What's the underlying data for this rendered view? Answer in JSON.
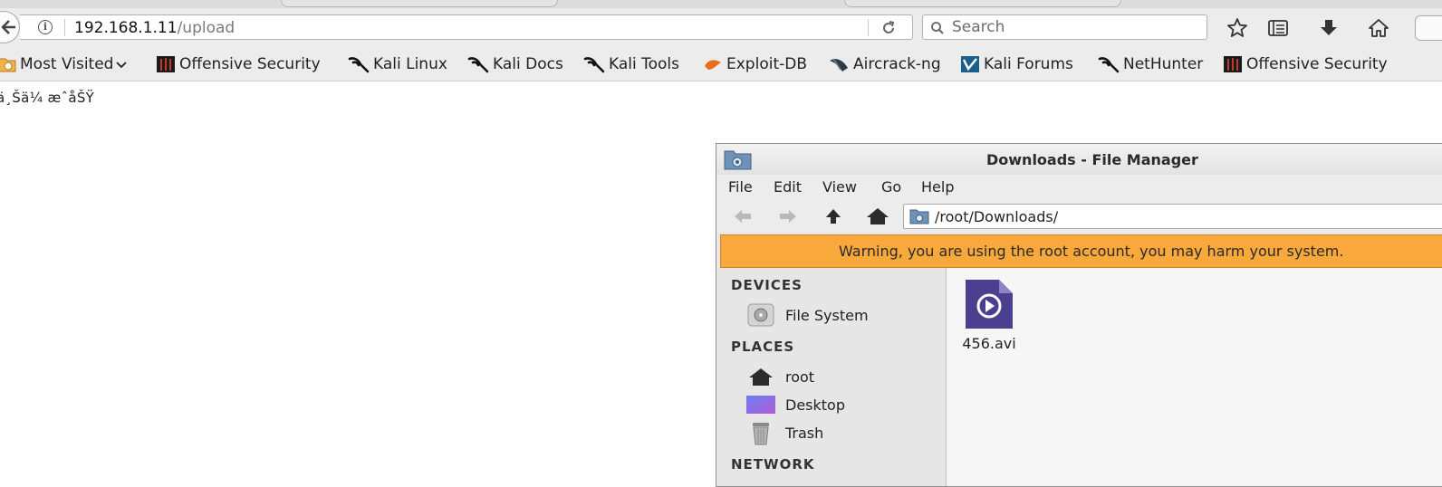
{
  "browser": {
    "url_host": "192.168.1.11",
    "url_path": "/upload",
    "search_placeholder": "Search",
    "toolbar_icons": [
      "back-icon",
      "info-icon",
      "reload-icon",
      "search-icon",
      "bookmark-star-icon",
      "reading-list-icon",
      "download-icon",
      "home-icon"
    ]
  },
  "bookmarks": [
    {
      "label": "Most Visited",
      "icon": "folder-clock-icon"
    },
    {
      "label": "Offensive Security",
      "icon": "offsec-icon"
    },
    {
      "label": "Kali Linux",
      "icon": "kali-dragon-icon"
    },
    {
      "label": "Kali Docs",
      "icon": "kali-dragon-icon"
    },
    {
      "label": "Kali Tools",
      "icon": "kali-dragon-icon"
    },
    {
      "label": "Exploit-DB",
      "icon": "exploitdb-icon"
    },
    {
      "label": "Aircrack-ng",
      "icon": "aircrack-icon"
    },
    {
      "label": "Kali Forums",
      "icon": "forums-icon"
    },
    {
      "label": "NetHunter",
      "icon": "kali-dragon-icon"
    },
    {
      "label": "Offensive Security",
      "icon": "offsec-icon"
    }
  ],
  "page": {
    "garbled_text": "ä¸Šä¼ æˆåŠŸ"
  },
  "file_manager": {
    "title": "Downloads - File Manager",
    "menu": [
      "File",
      "Edit",
      "View",
      "Go",
      "Help"
    ],
    "path": "/root/Downloads/",
    "warning": "Warning, you are using the root account, you may harm your system.",
    "sections": {
      "devices": "DEVICES",
      "places": "PLACES",
      "network": "NETWORK"
    },
    "devices": [
      {
        "label": "File System",
        "icon": "drive-icon"
      }
    ],
    "places": [
      {
        "label": "root",
        "icon": "home-icon"
      },
      {
        "label": "Desktop",
        "icon": "desktop-icon"
      },
      {
        "label": "Trash",
        "icon": "trash-icon"
      }
    ],
    "files": [
      {
        "name": "456.avi",
        "icon": "video-file-icon"
      }
    ],
    "colors": {
      "warning_bg": "#f9a83b",
      "file_icon": "#4b3f8f"
    }
  }
}
